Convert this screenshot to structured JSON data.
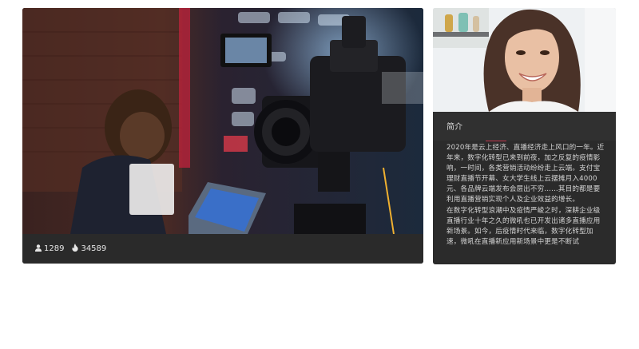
{
  "video": {
    "viewers_icon": "user-icon",
    "viewers": "1289",
    "heat_icon": "flame-icon",
    "heat": "34589"
  },
  "profile": {
    "tab_label": "简介",
    "paragraphs": [
      "2020年是云上经济、直播经济走上风口的一年。近年来，数字化转型已来到前夜，加之反复的疫情影响，一时间，各类营销活动纷纷走上云端。支付宝理财直播节开幕、女大学生线上云摆摊月入4000元、各品牌云端发布会层出不穷……其目的都是要利用直播营销实现个人及企业效益的增长。",
      "在数字化转型浪潮中及疫情严峻之时，深耕企业级直播行业十年之久的微吼也已开发出诸多直播应用新场景。如今，后疫情时代来临，数字化转型加速，微吼在直播新应用新场景中更是不断试"
    ]
  }
}
